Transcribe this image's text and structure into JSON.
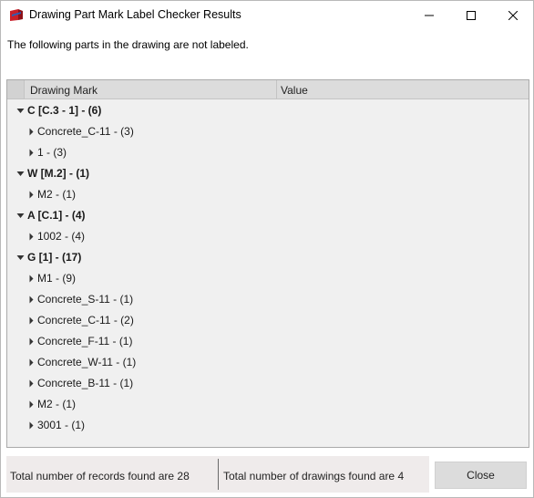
{
  "window": {
    "title": "Drawing Part Mark Label Checker Results",
    "icons": {
      "app": "drawing-app-icon",
      "minimize": "minimize-icon",
      "maximize": "maximize-icon",
      "close": "close-icon"
    }
  },
  "intro_text": "The following parts in the drawing are not labeled.",
  "grid": {
    "columns": [
      {
        "label": "Drawing Mark"
      },
      {
        "label": "Value"
      }
    ],
    "groups": [
      {
        "label": "C [C.3 - 1] - (6)",
        "expanded": true,
        "children": [
          {
            "label": "Concrete_C-11 - (3)"
          },
          {
            "label": "1 - (3)"
          }
        ]
      },
      {
        "label": "W [M.2] - (1)",
        "expanded": true,
        "children": [
          {
            "label": "M2 - (1)"
          }
        ]
      },
      {
        "label": "A [C.1] - (4)",
        "expanded": true,
        "children": [
          {
            "label": "1002 - (4)"
          }
        ]
      },
      {
        "label": "G [1] - (17)",
        "expanded": true,
        "children": [
          {
            "label": "M1 - (9)"
          },
          {
            "label": "Concrete_S-11 - (1)"
          },
          {
            "label": "Concrete_C-11 - (2)"
          },
          {
            "label": "Concrete_F-11 - (1)"
          },
          {
            "label": "Concrete_W-11 - (1)"
          },
          {
            "label": "Concrete_B-11 - (1)"
          },
          {
            "label": "M2 - (1)"
          },
          {
            "label": "3001 - (1)"
          }
        ]
      }
    ]
  },
  "footer": {
    "records": "Total number of records found are 28",
    "drawings": "Total number of drawings found are 4",
    "close_label": "Close"
  }
}
